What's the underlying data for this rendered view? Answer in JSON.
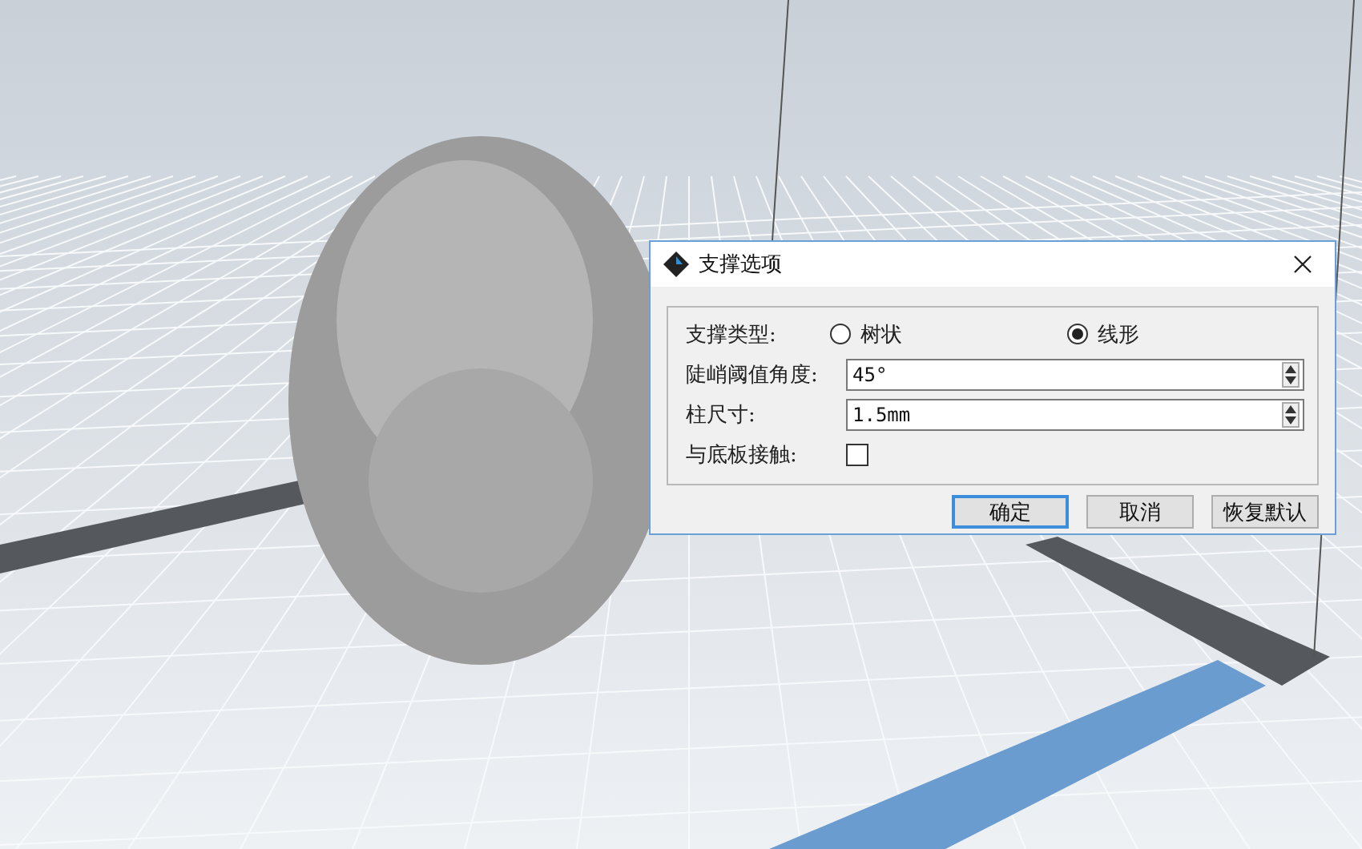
{
  "dialog": {
    "title": "支撑选项",
    "support_type": {
      "label": "支撑类型:",
      "options": [
        {
          "label": "树状",
          "selected": false
        },
        {
          "label": "线形",
          "selected": true
        }
      ]
    },
    "fields": [
      {
        "label": "陡峭阈值角度:",
        "value": "45°"
      },
      {
        "label": "柱尺寸:",
        "value": "1.5mm"
      }
    ],
    "contact": {
      "label": "与底板接触:",
      "checked": false
    },
    "buttons": [
      {
        "label": "确定",
        "default": true
      },
      {
        "label": "取消",
        "default": false
      },
      {
        "label": "恢复默认",
        "default": false
      }
    ]
  }
}
